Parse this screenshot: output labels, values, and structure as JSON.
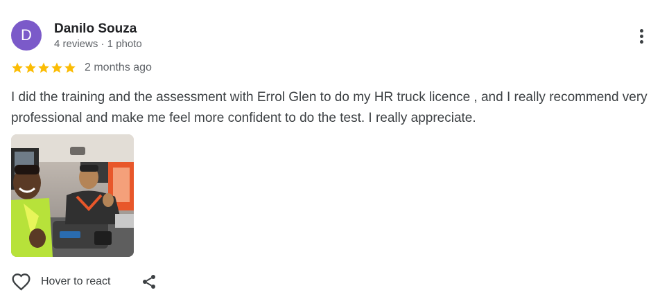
{
  "reviewer": {
    "initial": "D",
    "name": "Danilo Souza",
    "meta": "4 reviews · 1 photo",
    "avatar_color": "#7b5ac9"
  },
  "rating": {
    "stars": 5,
    "max_stars": 5,
    "star_color": "#fbbc04",
    "time_ago": "2 months ago"
  },
  "review": {
    "text": "I did the training and the assessment with Errol Glen to do my HR truck licence , and I really recommend very professional and make me feel more confident to do the test. I really appreciate."
  },
  "photo": {
    "icon": "review-photo"
  },
  "actions": {
    "react_label": "Hover to react",
    "react_icon": "heart-outline-icon",
    "share_icon": "share-icon",
    "more_icon": "more-vert-icon"
  }
}
